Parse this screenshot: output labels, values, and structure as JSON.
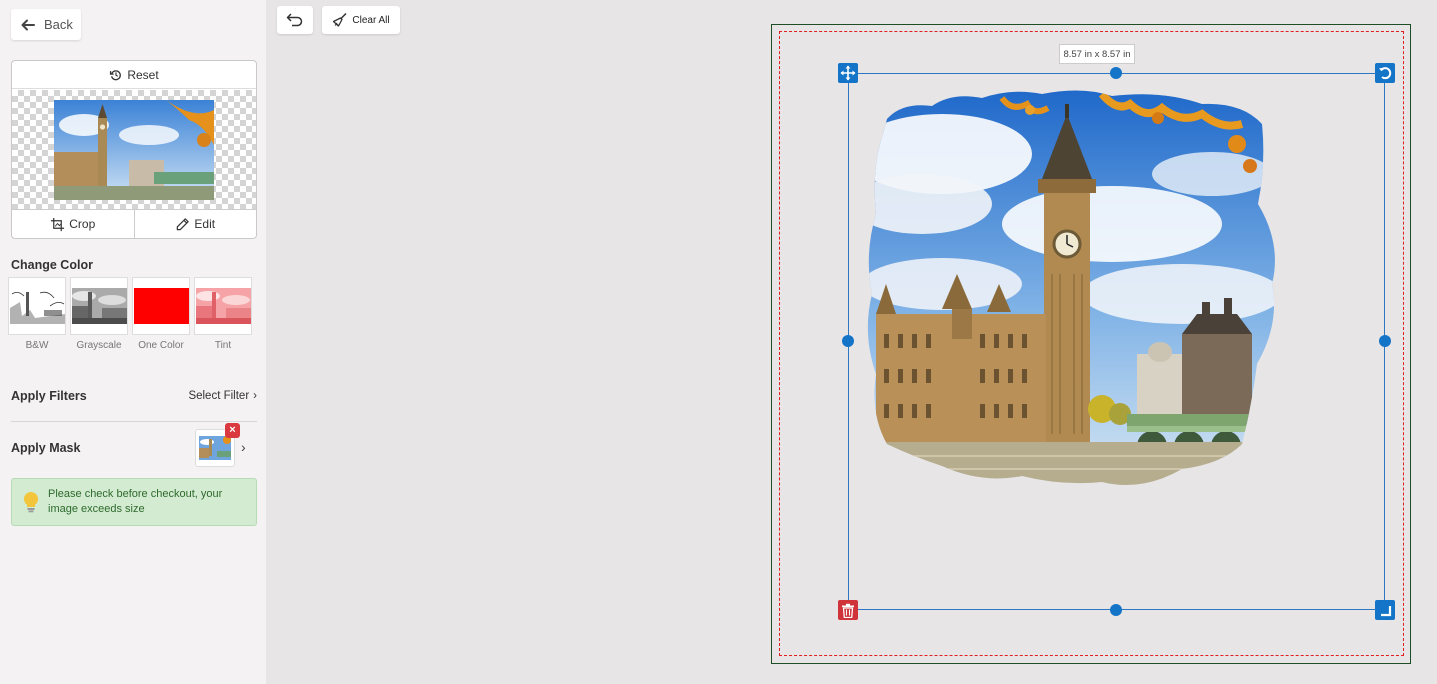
{
  "sidebar": {
    "back_label": "Back",
    "reset_label": "Reset",
    "crop_label": "Crop",
    "edit_label": "Edit",
    "change_color_title": "Change Color",
    "color_options": [
      {
        "label": "B&W"
      },
      {
        "label": "Grayscale"
      },
      {
        "label": "One Color",
        "color": "#ff0000"
      },
      {
        "label": "Tint"
      }
    ],
    "apply_filters_label": "Apply Filters",
    "select_filter_label": "Select Filter",
    "apply_mask_label": "Apply Mask",
    "notice_text": "Please check before checkout, your image exceeds size"
  },
  "toolbar": {
    "clear_all_label": "Clear All"
  },
  "canvas": {
    "size_label": "8.57 in x 8.57 in"
  },
  "colors": {
    "accent": "#1374c8",
    "danger": "#d9393f",
    "notice_bg": "#d2ebd1"
  }
}
